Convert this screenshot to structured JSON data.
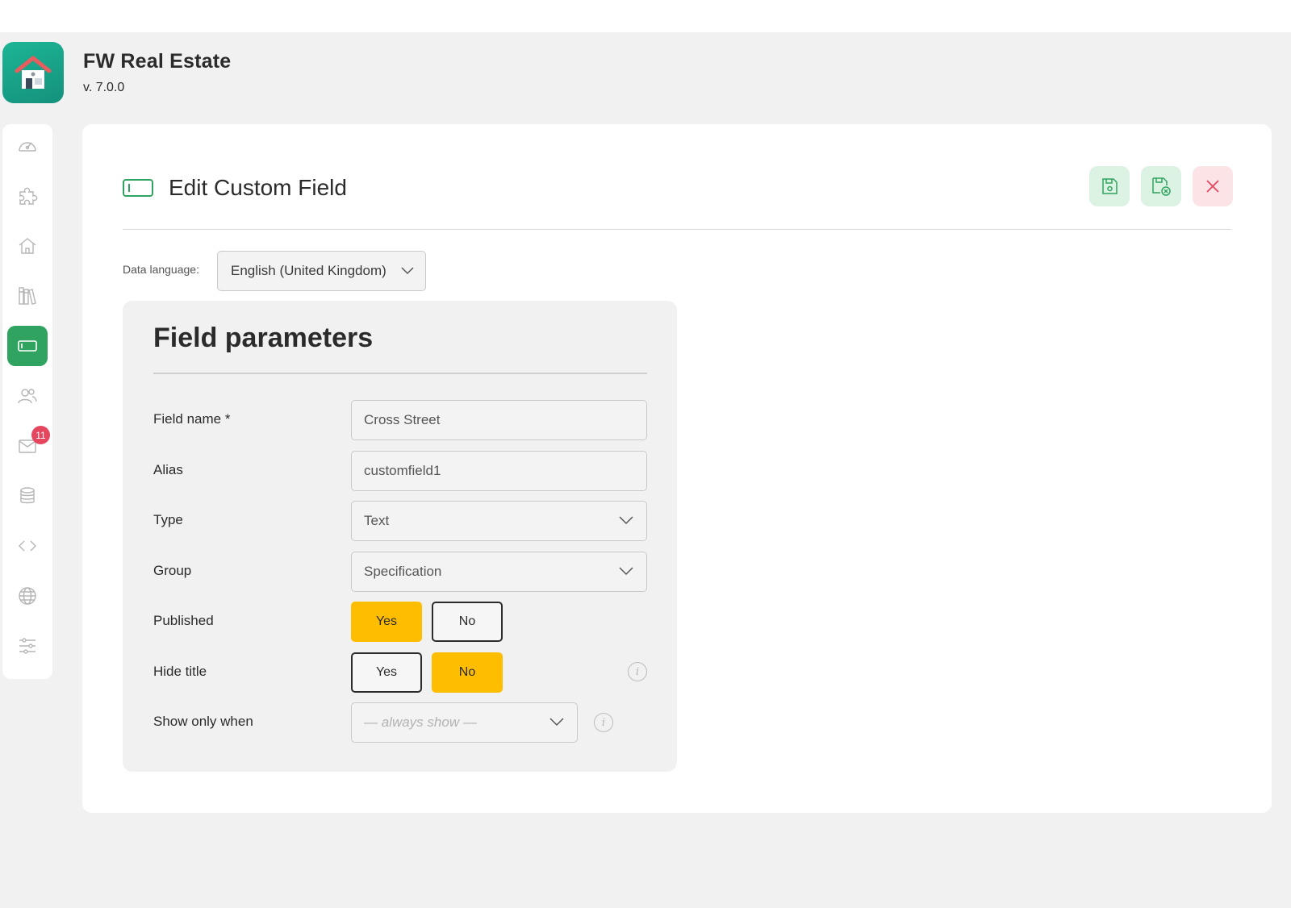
{
  "app": {
    "title": "FW Real Estate",
    "version": "v. 7.0.0"
  },
  "sidebar": {
    "items": [
      {
        "icon": "dashboard-gauge-icon",
        "active": false
      },
      {
        "icon": "puzzle-icon",
        "active": false
      },
      {
        "icon": "home-icon",
        "active": false
      },
      {
        "icon": "library-books-icon",
        "active": false
      },
      {
        "icon": "custom-field-icon",
        "active": true
      },
      {
        "icon": "users-icon",
        "active": false
      },
      {
        "icon": "mail-icon",
        "active": false,
        "badge": "11"
      },
      {
        "icon": "database-icon",
        "active": false
      },
      {
        "icon": "code-icon",
        "active": false
      },
      {
        "icon": "globe-icon",
        "active": false
      },
      {
        "icon": "settings-sliders-icon",
        "active": false
      }
    ]
  },
  "header": {
    "title": "Edit Custom Field",
    "buttons": [
      "save-icon",
      "save-and-close-icon",
      "close-icon"
    ]
  },
  "language": {
    "label": "Data language:",
    "value": "English (United Kingdom)"
  },
  "panel": {
    "title": "Field parameters",
    "field_name": {
      "label": "Field name *",
      "value": "Cross Street"
    },
    "alias": {
      "label": "Alias",
      "value": "customfield1"
    },
    "type": {
      "label": "Type",
      "value": "Text"
    },
    "group": {
      "label": "Group",
      "value": "Specification"
    },
    "published": {
      "label": "Published",
      "yes": "Yes",
      "no": "No",
      "selected": "Yes"
    },
    "hide_title": {
      "label": "Hide title",
      "yes": "Yes",
      "no": "No",
      "selected": "No"
    },
    "show_only_when": {
      "label": "Show only when",
      "placeholder": "— always show —"
    }
  },
  "colors": {
    "accent_green": "#2fa35f",
    "toggle_active": "#ffbd00",
    "close_red": "#e5475f",
    "logo_teal": "#1db596"
  }
}
